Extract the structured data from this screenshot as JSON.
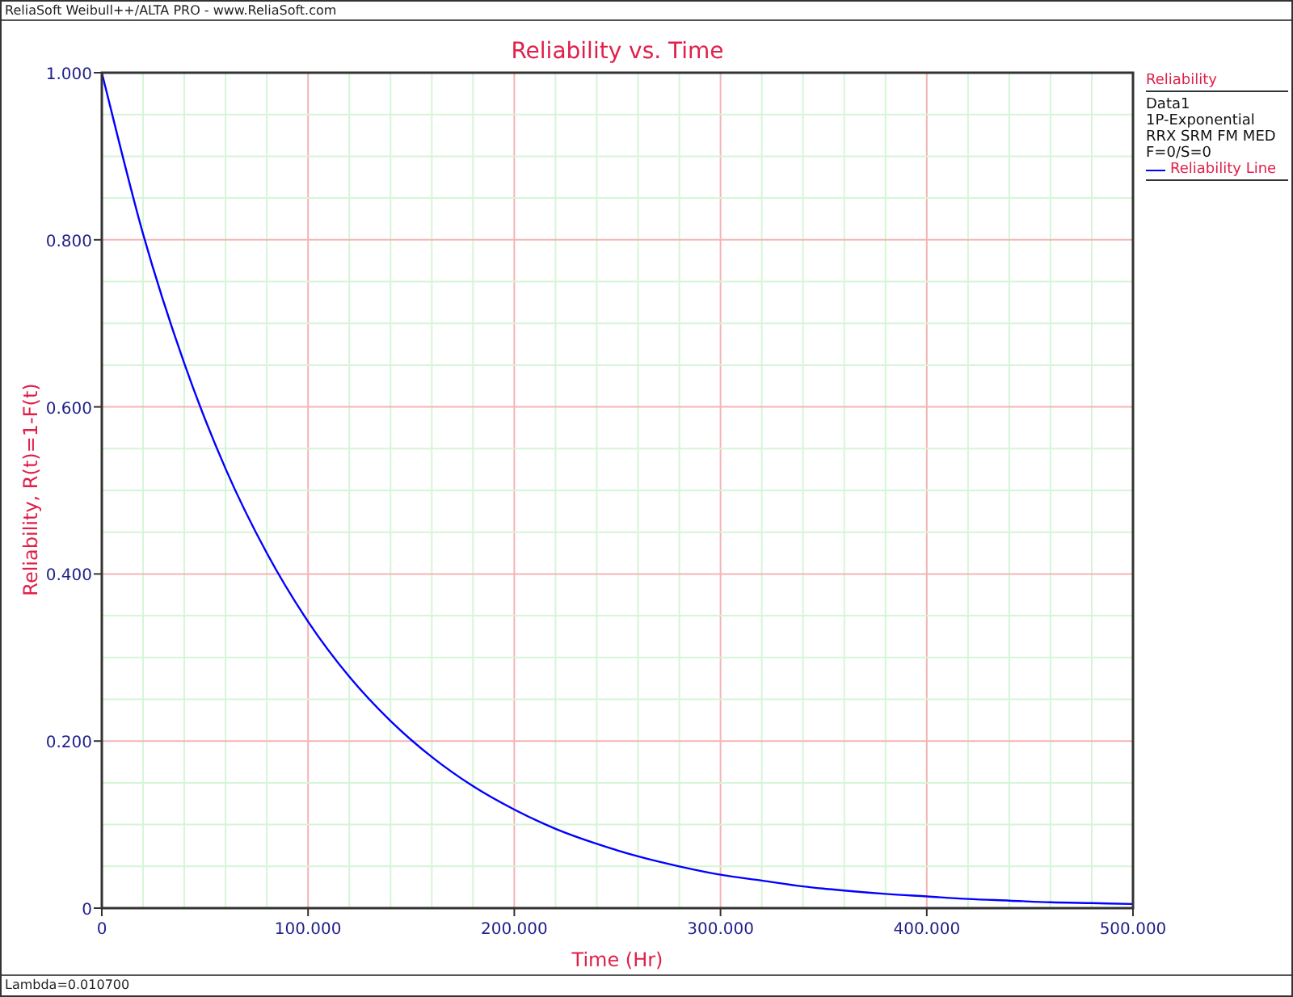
{
  "window": {
    "title": "ReliaSoft Weibull++/ALTA PRO - www.ReliaSoft.com"
  },
  "chart": {
    "chart_data": {
      "type": "line",
      "title": "Reliability vs. Time",
      "xlabel": "Time (Hr)",
      "ylabel": "Reliability, R(t)=1-F(t)",
      "x": [
        0,
        20,
        40,
        60,
        80,
        100,
        120,
        140,
        160,
        180,
        200,
        220,
        240,
        260,
        280,
        300,
        320,
        340,
        360,
        380,
        400,
        420,
        440,
        460,
        480,
        500
      ],
      "series": [
        {
          "name": "Reliability Line",
          "color": "#0000ff",
          "values": [
            1,
            0.807,
            0.652,
            0.526,
            0.425,
            0.343,
            0.277,
            0.224,
            0.181,
            0.146,
            0.118,
            0.095,
            0.077,
            0.062,
            0.05,
            0.04,
            0.033,
            0.026,
            0.021,
            0.017,
            0.014,
            0.011,
            0.009,
            0.007,
            0.006,
            0.005
          ]
        }
      ],
      "grid": true,
      "xlim": [
        0,
        500
      ],
      "ylim": [
        0,
        1
      ],
      "xticks": [
        {
          "value": 0,
          "label": "0"
        },
        {
          "value": 100,
          "label": "100.000"
        },
        {
          "value": 200,
          "label": "200.000"
        },
        {
          "value": 300,
          "label": "300.000"
        },
        {
          "value": 400,
          "label": "400.000"
        },
        {
          "value": 500,
          "label": "500.000"
        }
      ],
      "yticks": [
        {
          "value": 0,
          "label": "0"
        },
        {
          "value": 0.2,
          "label": "0.200"
        },
        {
          "value": 0.4,
          "label": "0.400"
        },
        {
          "value": 0.6,
          "label": "0.600"
        },
        {
          "value": 0.8,
          "label": "0.800"
        },
        {
          "value": 1,
          "label": "1.000"
        }
      ]
    }
  },
  "legend": {
    "title": "Reliability",
    "lines": [
      "Data1",
      "1P-Exponential",
      "RRX SRM FM MED",
      "F=0/S=0"
    ]
  },
  "status_bar": "Lambda=0.010700"
}
